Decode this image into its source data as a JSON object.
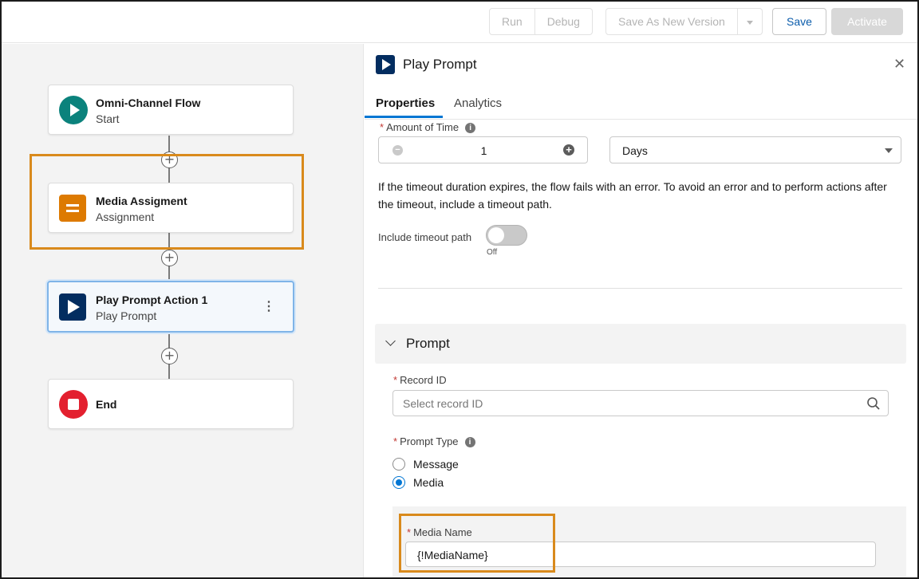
{
  "toolbar": {
    "run": "Run",
    "debug": "Debug",
    "save_as_new_version": "Save As New Version",
    "save": "Save",
    "activate": "Activate"
  },
  "canvas": {
    "nodes": [
      {
        "title": "Omni-Channel Flow",
        "subtitle": "Start",
        "icon": "play-circle-icon",
        "color": "#04844b"
      },
      {
        "title": "Media Assigment",
        "subtitle": "Assignment",
        "icon": "assignment-icon",
        "color": "#dd7a01"
      },
      {
        "title": "Play Prompt Action 1",
        "subtitle": "Play Prompt",
        "icon": "play-prompt-icon",
        "color": "#032d60"
      },
      {
        "title": "End",
        "subtitle": "",
        "icon": "stop-icon",
        "color": "#ea001e"
      }
    ]
  },
  "panel": {
    "title": "Play Prompt",
    "tabs": [
      "Properties",
      "Analytics"
    ],
    "amount_of_time": {
      "label": "Amount of Time",
      "value": "1",
      "unit": "Days"
    },
    "help_text": "If the timeout duration expires, the flow fails with an error. To avoid an error and to perform actions after the timeout, include a timeout path.",
    "include_timeout": {
      "label": "Include timeout path",
      "state": "Off"
    },
    "prompt_section": {
      "title": "Prompt",
      "record_id_label": "Record ID",
      "record_id_placeholder": "Select record ID",
      "prompt_type_label": "Prompt Type",
      "options": [
        "Message",
        "Media"
      ],
      "selected": "Media",
      "media_name_label": "Media Name",
      "media_name_value": "{!MediaName}"
    }
  },
  "colors": {
    "accent": "#0176d3",
    "highlight": "#d98a1c"
  }
}
